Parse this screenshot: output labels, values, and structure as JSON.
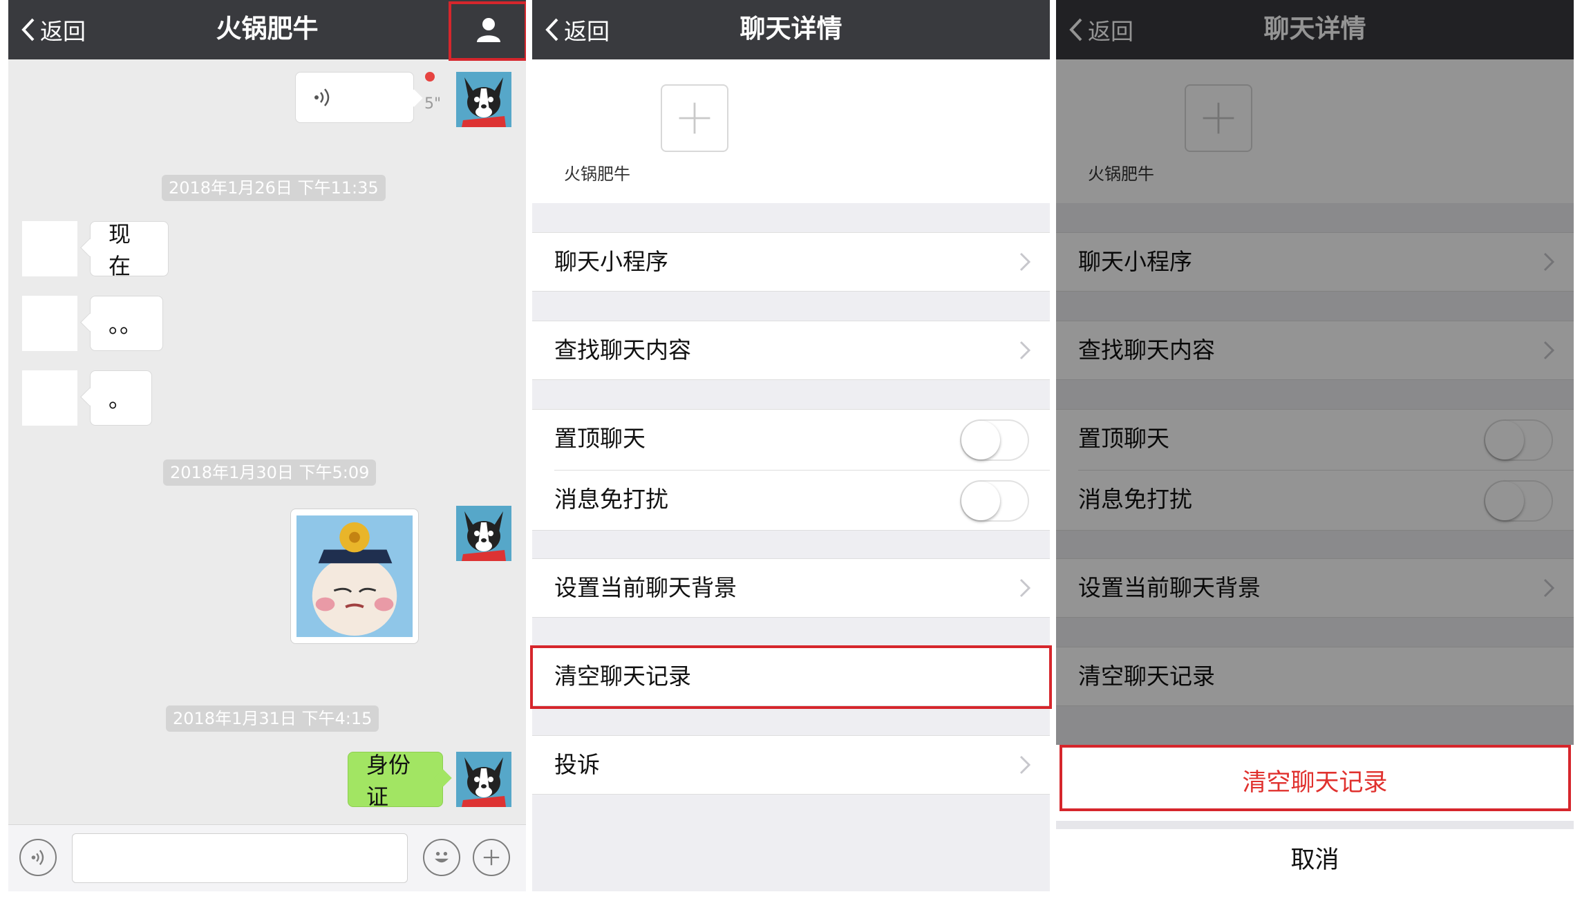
{
  "chat": {
    "back_label": "返回",
    "title": "火锅肥牛",
    "voice_duration": "5\"",
    "timestamps": [
      "2018年1月26日 下午11:35",
      "2018年1月30日 下午5:09",
      "2018年1月31日 下午4:15"
    ],
    "messages": {
      "m1": "现在",
      "m2": "。。",
      "m3": "。",
      "m4": "身份证"
    }
  },
  "details": {
    "back_label": "返回",
    "title": "聊天详情",
    "member_name": "火锅肥牛",
    "rows": {
      "mini_programs": "聊天小程序",
      "search_history": "查找聊天内容",
      "sticky_on_top": "置顶聊天",
      "mute": "消息免打扰",
      "set_background": "设置当前聊天背景",
      "clear_history": "清空聊天记录",
      "report": "投诉"
    },
    "toggles": {
      "sticky_on_top": false,
      "mute": false
    }
  },
  "action_sheet": {
    "confirm_label": "清空聊天记录",
    "cancel_label": "取消"
  },
  "colors": {
    "navbar": "#393a3e",
    "highlight": "#d6262c",
    "green_bubble": "#a2e563",
    "destructive": "#e0312e"
  }
}
